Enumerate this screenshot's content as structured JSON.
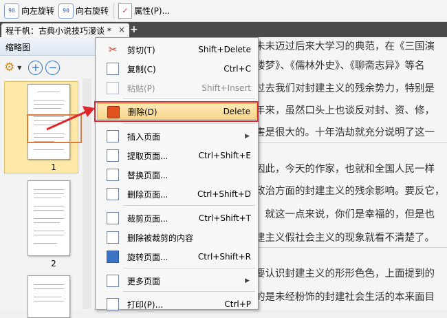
{
  "toolbar": {
    "rotate_left": "向左旋转",
    "rotate_right": "向右旋转",
    "rotate_glyph": "90",
    "properties": "属性(P)..."
  },
  "tab": {
    "title": "程千帆：古典小说技巧漫谈 *",
    "close": "×",
    "add": "+"
  },
  "thumbnails": {
    "header": "缩略图",
    "zoom_in": "+",
    "zoom_out": "−",
    "pages": [
      {
        "number": "1",
        "selected": true
      },
      {
        "number": "2",
        "selected": false
      }
    ]
  },
  "document": {
    "lines": [
      "朱未迈过后来大学习的典范，在《三国演",
      "楼梦》、《儒林外史》、《聊斋志异》等名",
      "过去我们对封建主义的残余势力，特别是",
      "年来，虽然口头上也谈反对封、资、修，",
      "害是很大的。十年浩劫就充分说明了这一",
      "因此，今天的作家，也就和全国人民一样",
      "政治方面的封建主义的残余影响。要反它，",
      "。就这一点来说，你们是幸福的，但是也",
      "建主义假社会主义的现象就看不清楚了。",
      "要认识封建主义的形形色色，上面提到的",
      "的是未经粉饰的封建社会生活的本来面目"
    ]
  },
  "context_menu": {
    "items": [
      {
        "icon": "scissors-icon",
        "label": "剪切(T)",
        "shortcut": "Shift+Delete",
        "disabled": false
      },
      {
        "icon": "copy-icon",
        "label": "复制(C)",
        "shortcut": "Ctrl+C",
        "disabled": false
      },
      {
        "icon": "paste-icon",
        "label": "粘贴(P)",
        "shortcut": "Shift+Insert",
        "disabled": true
      },
      {
        "icon": "trash-icon",
        "label": "删除(D)",
        "shortcut": "Delete",
        "disabled": false,
        "highlighted": true
      },
      {
        "icon": "insert-page-icon",
        "label": "插入页面",
        "shortcut": "",
        "submenu": true
      },
      {
        "icon": "extract-page-icon",
        "label": "提取页面...",
        "shortcut": "Ctrl+Shift+E"
      },
      {
        "icon": "replace-page-icon",
        "label": "替换页面...",
        "shortcut": ""
      },
      {
        "icon": "delete-page-icon",
        "label": "删除页面...",
        "shortcut": "Ctrl+Shift+D"
      },
      {
        "icon": "crop-page-icon",
        "label": "裁剪页面...",
        "shortcut": "Ctrl+Shift+T"
      },
      {
        "icon": "remove-cropped-icon",
        "label": "删除被裁剪的内容",
        "shortcut": ""
      },
      {
        "icon": "rotate-page-icon",
        "label": "旋转页面...",
        "shortcut": "Ctrl+Shift+R"
      },
      {
        "icon": "more-pages-icon",
        "label": "更多页面",
        "shortcut": "",
        "submenu": true
      },
      {
        "icon": "print-icon",
        "label": "打印(P)...",
        "shortcut": "Ctrl+P"
      }
    ],
    "submenu_arrow": "▶"
  },
  "colors": {
    "highlight_frame": "#e0242a",
    "menu_highlight": "#f8d68a",
    "accent_blue": "#2c6fc0"
  }
}
